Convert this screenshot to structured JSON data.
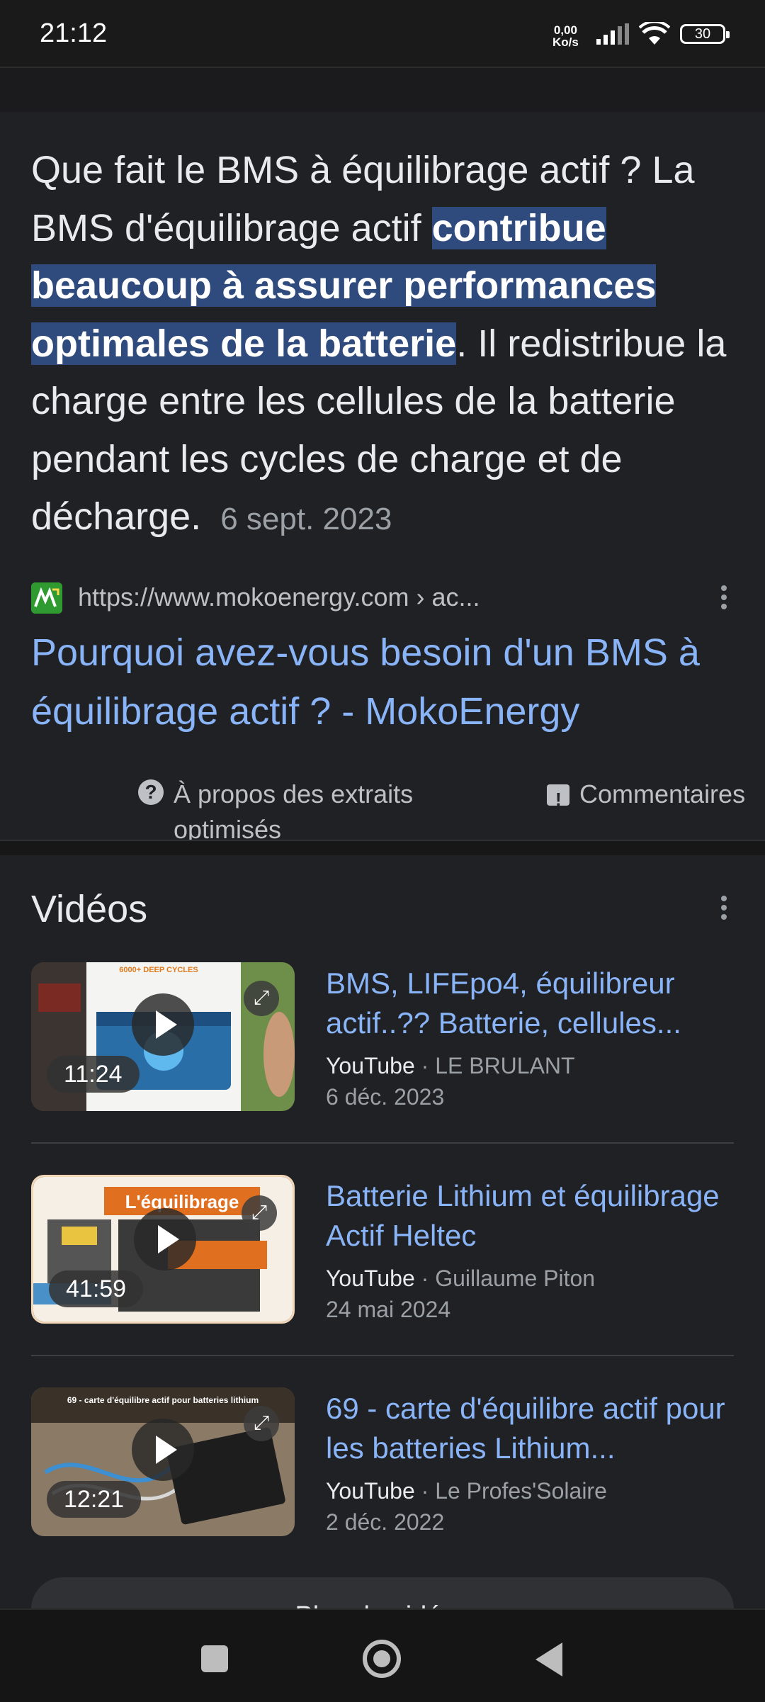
{
  "status_bar": {
    "time": "21:12",
    "speed_value": "0,00",
    "speed_unit": "Ko/s",
    "battery": "30"
  },
  "snippet": {
    "text_before": "Que fait le BMS à équilibrage actif ? La BMS d'équilibrage actif ",
    "text_highlight": "contribue beaucoup à assurer performances optimales de la batterie",
    "text_after": ". Il redistribue la charge entre les cellules de la batterie pendant les cycles de charge et de décharge.",
    "date": "6 sept. 2023",
    "source_url": "https://www.mokoenergy.com › ac...",
    "favicon_label": "ML",
    "title": "Pourquoi avez-vous besoin d'un BMS à équilibrage actif ? - MokoEnergy",
    "about_label": "À propos des extraits optimisés",
    "feedback_label": "Commentaires"
  },
  "videos": {
    "heading": "Vidéos",
    "items": [
      {
        "title": "BMS, LIFEpo4, équilibreur actif..?? Batterie, cellules...",
        "platform": "YouTube",
        "channel": "LE BRULANT",
        "date": "6 déc. 2023",
        "duration": "11:24",
        "thumb_caption": "6000+ DEEP CYCLES"
      },
      {
        "title": "Batterie Lithium et équilibrage Actif Heltec",
        "platform": "YouTube",
        "channel": "Guillaume Piton",
        "date": "24 mai 2024",
        "duration": "41:59",
        "thumb_caption": "L'équilibrage"
      },
      {
        "title": "69 - carte d'équilibre actif pour les batteries Lithium...",
        "platform": "YouTube",
        "channel": "Le Profes'Solaire",
        "date": "2 déc. 2022",
        "duration": "12:21",
        "thumb_caption": "69 - carte d'équilibre actif pour batteries lithium"
      }
    ],
    "more_label": "Plus de vidéos"
  },
  "colors": {
    "background": "#202124",
    "link": "#8ab4f8",
    "highlight": "#2f4a7c",
    "muted": "#9aa0a6"
  }
}
